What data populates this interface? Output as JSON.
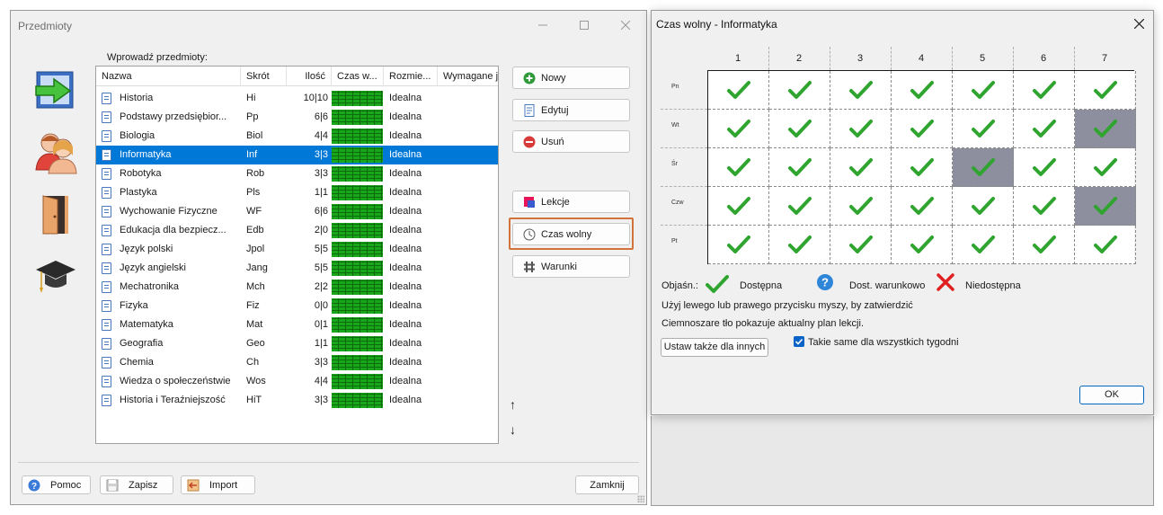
{
  "main_window": {
    "title": "Przedmioty",
    "list_label": "Wprowadź przedmioty:",
    "columns": [
      "Nazwa",
      "Skrót",
      "Ilość",
      "Czas w...",
      "Rozmie...",
      "Wymagane j"
    ],
    "rows": [
      {
        "name": "Historia",
        "short": "Hi",
        "qty": "10|10",
        "size": "Idealna"
      },
      {
        "name": "Podstawy przedsiębior...",
        "short": "Pp",
        "qty": "6|6",
        "size": "Idealna"
      },
      {
        "name": "Biologia",
        "short": "Biol",
        "qty": "4|4",
        "size": "Idealna"
      },
      {
        "name": "Informatyka",
        "short": "Inf",
        "qty": "3|3",
        "size": "Idealna",
        "selected": true
      },
      {
        "name": "Robotyka",
        "short": "Rob",
        "qty": "3|3",
        "size": "Idealna"
      },
      {
        "name": "Plastyka",
        "short": "Pls",
        "qty": "1|1",
        "size": "Idealna"
      },
      {
        "name": "Wychowanie Fizyczne",
        "short": "WF",
        "qty": "6|6",
        "size": "Idealna"
      },
      {
        "name": "Edukacja dla bezpiecz...",
        "short": "Edb",
        "qty": "2|0",
        "size": "Idealna"
      },
      {
        "name": "Język polski",
        "short": "Jpol",
        "qty": "5|5",
        "size": "Idealna"
      },
      {
        "name": "Język angielski",
        "short": "Jang",
        "qty": "5|5",
        "size": "Idealna"
      },
      {
        "name": "Mechatronika",
        "short": "Mch",
        "qty": "2|2",
        "size": "Idealna"
      },
      {
        "name": "Fizyka",
        "short": "Fiz",
        "qty": "0|0",
        "size": "Idealna"
      },
      {
        "name": "Matematyka",
        "short": "Mat",
        "qty": "0|1",
        "size": "Idealna"
      },
      {
        "name": "Geografia",
        "short": "Geo",
        "qty": "1|1",
        "size": "Idealna"
      },
      {
        "name": "Chemia",
        "short": "Ch",
        "qty": "3|3",
        "size": "Idealna"
      },
      {
        "name": "Wiedza o społeczeństwie",
        "short": "Wos",
        "qty": "4|4",
        "size": "Idealna"
      },
      {
        "name": "Historia i Teraźniejszość",
        "short": "HiT",
        "qty": "3|3",
        "size": "Idealna"
      }
    ],
    "buttons": {
      "new": "Nowy",
      "edit": "Edytuj",
      "delete": "Usuń",
      "lessons": "Lekcje",
      "free_time": "Czas wolny",
      "conditions": "Warunki",
      "up": "↑",
      "down": "↓"
    },
    "bottom_buttons": {
      "help": "Pomoc",
      "save": "Zapisz",
      "import": "Import",
      "close": "Zamknij"
    },
    "side_icons": [
      "arrow-enter-icon",
      "teachers-icon",
      "door-icon",
      "graduation-cap-icon"
    ]
  },
  "dialog": {
    "title": "Czas wolny - Informatyka",
    "periods": [
      "1",
      "2",
      "3",
      "4",
      "5",
      "6",
      "7"
    ],
    "days": [
      "Pn",
      "Wt",
      "Śr",
      "Czw",
      "Pt"
    ],
    "busy_cells": [
      [
        1,
        6
      ],
      [
        2,
        4
      ],
      [
        3,
        6
      ]
    ],
    "legend": {
      "label": "Objaśn.:",
      "available": "Dostępna",
      "conditional": "Dost. warunkowo",
      "unavailable": "Niedostępna"
    },
    "note_1": "Użyj lewego lub prawego przycisku myszy, by zatwierdzić",
    "note_2": "Ciemnoszare tło pokazuje aktualny plan lekcji.",
    "set_for_others": "Ustaw także dla innych",
    "same_all_weeks": "Takie same dla wszystkich tygodni",
    "ok": "OK"
  },
  "colors": {
    "selection": "#0078d7",
    "check_green": "#2fa52f",
    "busy_gray": "#8d8e9e",
    "highlight_border": "#d2733b"
  }
}
